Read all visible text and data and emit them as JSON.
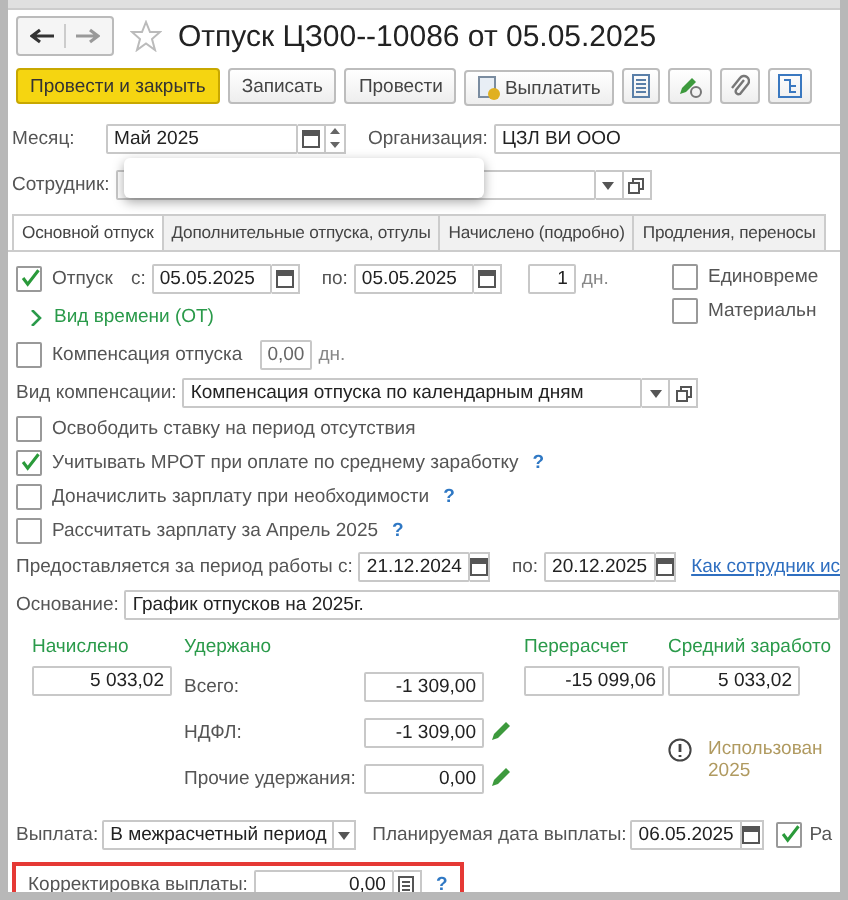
{
  "title": "Отпуск ЦЗ00--10086 от 05.05.2025",
  "toolbar": [
    {
      "kind": "primary",
      "label": "Провести и закрыть"
    },
    {
      "kind": "plain",
      "label": "Записать"
    },
    {
      "kind": "plain",
      "label": "Провести"
    },
    {
      "kind": "pay",
      "label": "Выплатить"
    },
    {
      "kind": "list"
    },
    {
      "kind": "edit"
    },
    {
      "kind": "clip"
    },
    {
      "kind": "structure"
    }
  ],
  "month": {
    "label": "Месяц:",
    "value": "Май 2025"
  },
  "organization": {
    "label": "Организация:",
    "value": "ЦЗЛ ВИ ООО"
  },
  "employee": {
    "label": "Сотрудник:"
  },
  "tabs": [
    {
      "label": "Основной отпуск",
      "selected": true
    },
    {
      "label": "Дополнительные отпуска, отгулы",
      "selected": false
    },
    {
      "label": "Начислено (подробно)",
      "selected": false
    },
    {
      "label": "Продления, переносы",
      "selected": false
    }
  ],
  "vacation": {
    "checked": true,
    "label": "Отпуск",
    "from_label": "с:",
    "from": "05.05.2025",
    "to_label": "по:",
    "to": "05.05.2025",
    "days": "1",
    "unit": "дн."
  },
  "side_checks": [
    {
      "label": "Единовреме",
      "checked": false
    },
    {
      "label": "Материальн",
      "checked": false
    }
  ],
  "time_kind": {
    "label": "Вид времени (ОТ)"
  },
  "compensation": {
    "checked": false,
    "label": "Компенсация отпуска",
    "value": "0,00",
    "unit": "дн."
  },
  "compensation_kind": {
    "label": "Вид компенсации:",
    "value": "Компенсация отпуска по календарным дням"
  },
  "options": [
    {
      "label": "Освободить ставку на период отсутствия",
      "checked": false
    },
    {
      "label": "Учитывать МРОТ при оплате по среднему заработку",
      "checked": true,
      "help": "?"
    },
    {
      "label": "Доначислить зарплату при необходимости",
      "checked": false,
      "help": "?"
    },
    {
      "label": "Рассчитать зарплату за Апрель 2025",
      "checked": false,
      "help": "?"
    }
  ],
  "work_period": {
    "label": "Предоставляется за период работы с:",
    "from": "21.12.2024",
    "to_label": "по:",
    "to": "20.12.2025",
    "link": "Как сотрудник ис"
  },
  "basis": {
    "label": "Основание:",
    "value": "График отпусков на 2025г."
  },
  "accrued": {
    "label": "Начислено",
    "value": "5 033,02"
  },
  "withheld": {
    "label": "Удержано",
    "rows": [
      {
        "label": "Всего:",
        "value": "-1 309,00",
        "editable": false
      },
      {
        "label": "НДФЛ:",
        "value": "-1 309,00",
        "editable": true
      },
      {
        "label": "Прочие удержания:",
        "value": "0,00",
        "editable": true
      }
    ]
  },
  "recalculation": {
    "label": "Перерасчет",
    "value": "-15 099,06"
  },
  "average": {
    "label": "Средний заработо",
    "value": "5 033,02"
  },
  "note": {
    "line_1": "Использован",
    "line_2": "2025"
  },
  "payment": {
    "label": "Выплата:",
    "value": "В межрасчетный период",
    "date_label": "Планируемая дата выплаты:",
    "date": "06.05.2025",
    "check_checked": true,
    "check_label": "Ра"
  },
  "correction": {
    "label": "Корректировка выплаты:",
    "value": "0,00",
    "help": "?",
    "highlighted": true
  }
}
